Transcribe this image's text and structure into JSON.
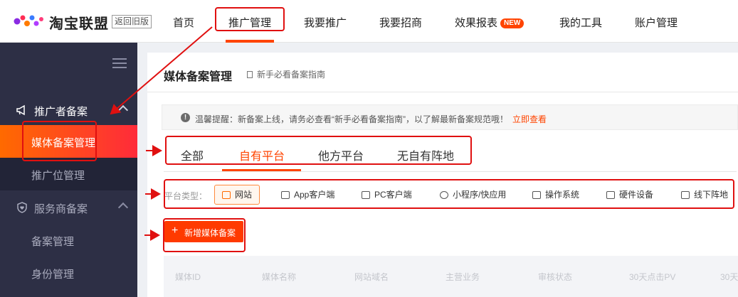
{
  "header": {
    "brand": "淘宝联盟",
    "old_version": "返回旧版",
    "nav": [
      {
        "label": "首页"
      },
      {
        "label": "推广管理"
      },
      {
        "label": "我要推广"
      },
      {
        "label": "我要招商"
      },
      {
        "label": "效果报表",
        "badge": "NEW"
      },
      {
        "label": "我的工具"
      },
      {
        "label": "账户管理"
      }
    ]
  },
  "sidebar": {
    "groups": [
      {
        "label": "推广者备案",
        "items": [
          {
            "label": "媒体备案管理"
          },
          {
            "label": "推广位管理"
          }
        ]
      },
      {
        "label": "服务商备案",
        "items": [
          {
            "label": "备案管理"
          },
          {
            "label": "身份管理"
          }
        ]
      }
    ]
  },
  "main": {
    "title": "媒体备案管理",
    "guide": "新手必看备案指南",
    "notice": {
      "text": "温馨提醒：新备案上线，请务必查看“新手必看备案指南”，以了解最新备案规范哦！",
      "link": "立即查看"
    },
    "tabs": [
      "全部",
      "自有平台",
      "他方平台",
      "无自有阵地"
    ],
    "platform_label": "平台类型：",
    "platform_types": [
      "网站",
      "App客户端",
      "PC客户端",
      "小程序/快应用",
      "操作系统",
      "硬件设备",
      "线下阵地"
    ],
    "add_button": "新增媒体备案",
    "table_headers": [
      "媒体ID",
      "媒体名称",
      "网站域名",
      "主营业务",
      "审核状态",
      "30天点击PV",
      "30天"
    ]
  },
  "colors": {
    "accent": "#ff4400",
    "sidebar": "#2d2f45",
    "annotation": "#e01010"
  }
}
